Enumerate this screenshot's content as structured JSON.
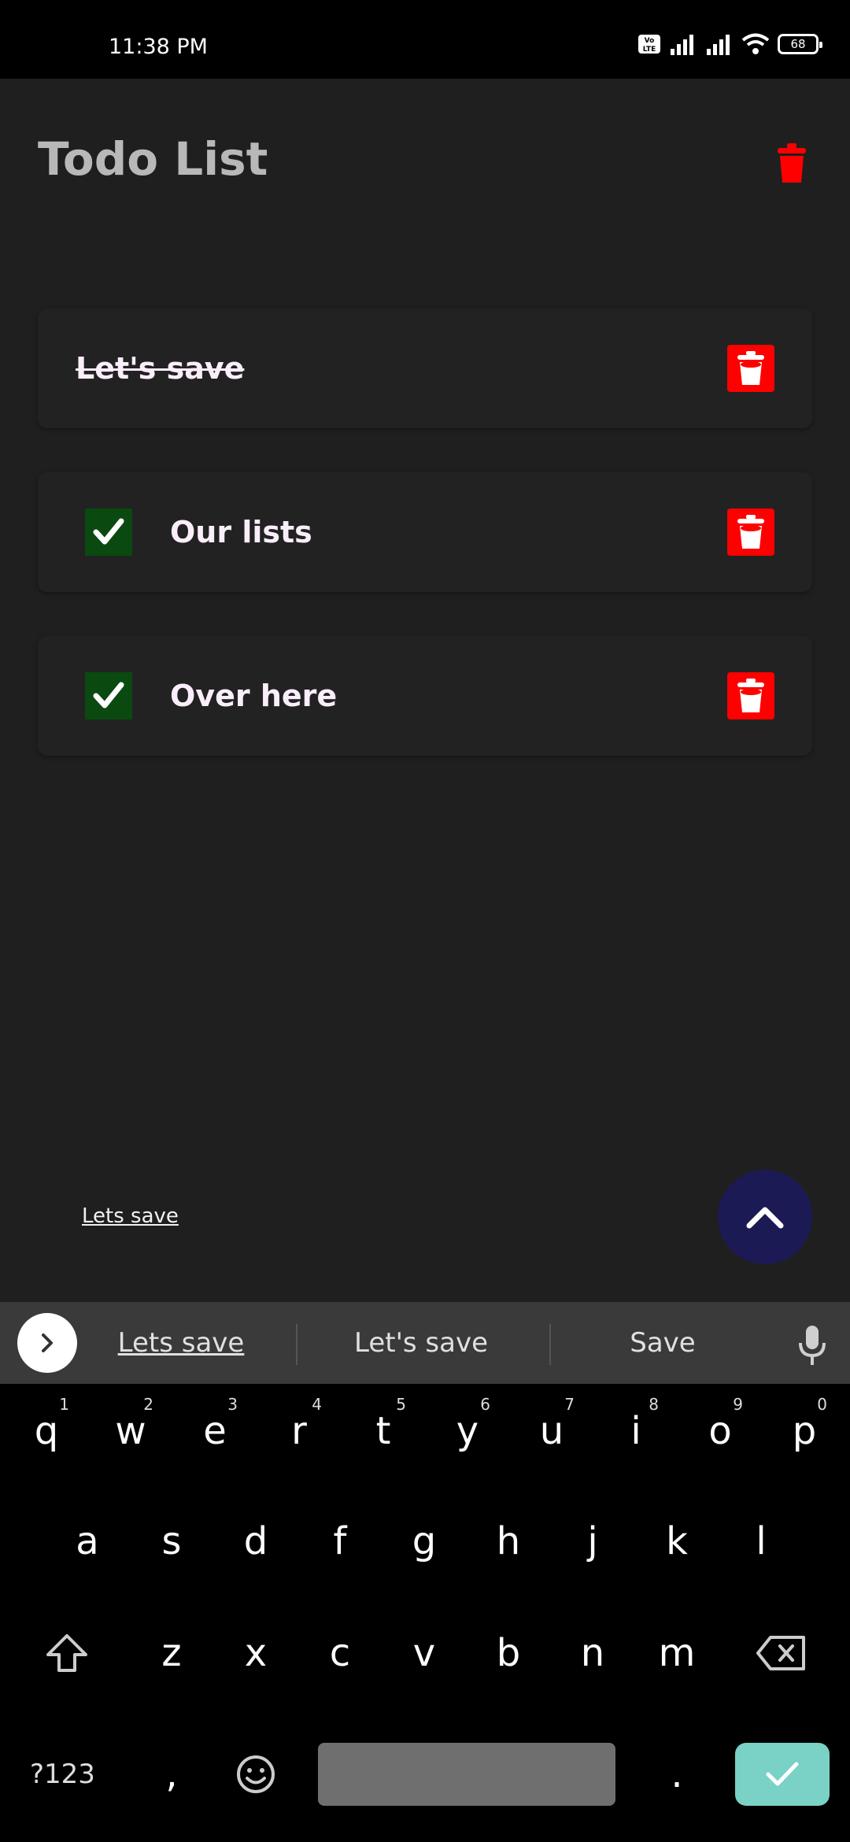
{
  "status": {
    "time": "11:38 PM",
    "battery": "68",
    "volte": "Vo LTE"
  },
  "app": {
    "title": "Todo List"
  },
  "todos": [
    {
      "text": "Let's save",
      "done": true
    },
    {
      "text": "Our lists",
      "checked": true
    },
    {
      "text": "Over here",
      "checked": true
    }
  ],
  "input": {
    "value": "Lets save"
  },
  "suggestions": [
    "Lets save",
    "Let's save",
    "Save"
  ],
  "keyboard": {
    "row1": [
      {
        "key": "q",
        "hint": "1"
      },
      {
        "key": "w",
        "hint": "2"
      },
      {
        "key": "e",
        "hint": "3"
      },
      {
        "key": "r",
        "hint": "4"
      },
      {
        "key": "t",
        "hint": "5"
      },
      {
        "key": "y",
        "hint": "6"
      },
      {
        "key": "u",
        "hint": "7"
      },
      {
        "key": "i",
        "hint": "8"
      },
      {
        "key": "o",
        "hint": "9"
      },
      {
        "key": "p",
        "hint": "0"
      }
    ],
    "row2": [
      "a",
      "s",
      "d",
      "f",
      "g",
      "h",
      "j",
      "k",
      "l"
    ],
    "row3": [
      "z",
      "x",
      "c",
      "v",
      "b",
      "n",
      "m"
    ],
    "symbols_label": "?123",
    "comma": ",",
    "period": "."
  },
  "colors": {
    "accent_red": "#ff0000",
    "check_green": "#0a4a10",
    "fab_navy": "#1c1a55",
    "enter_teal": "#7ad1c6"
  }
}
